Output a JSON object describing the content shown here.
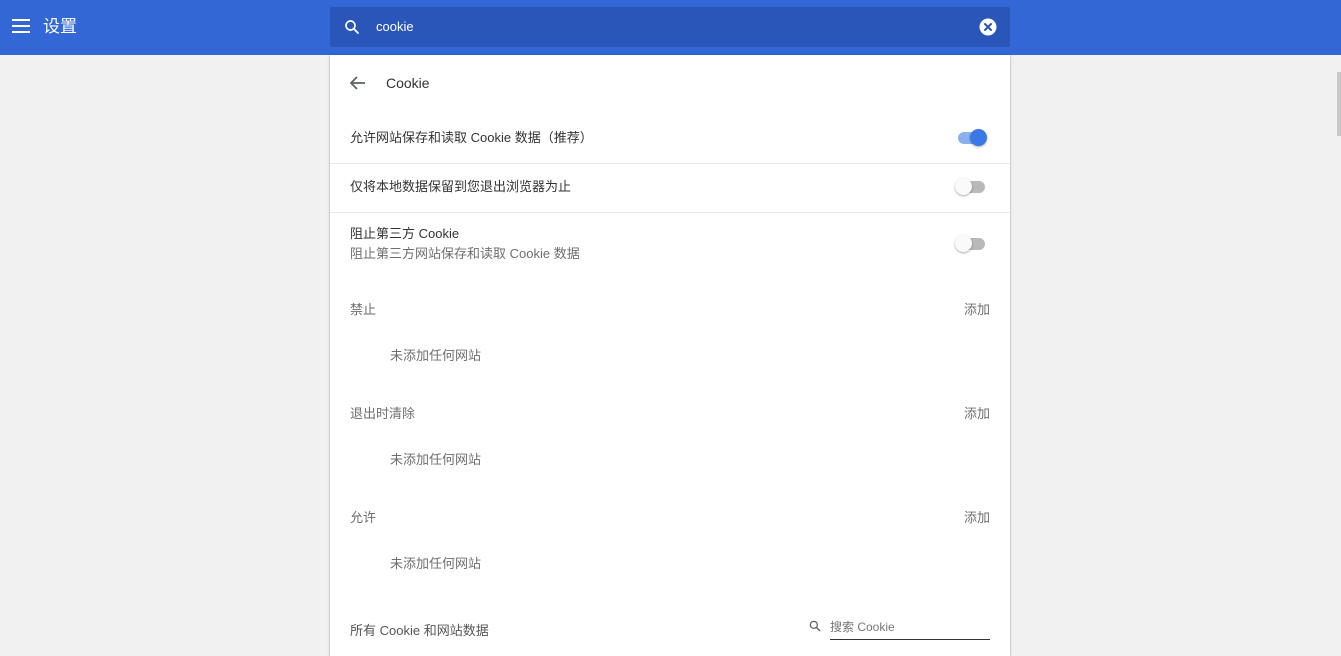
{
  "header": {
    "title": "设置",
    "search_value": "cookie"
  },
  "page": {
    "title": "Cookie"
  },
  "toggles": [
    {
      "label": "允许网站保存和读取 Cookie 数据（推荐）",
      "state": "on"
    },
    {
      "label": "仅将本地数据保留到您退出浏览器为止",
      "state": "off"
    },
    {
      "label": "阻止第三方 Cookie",
      "sublabel": "阻止第三方网站保存和读取 Cookie 数据",
      "state": "off"
    }
  ],
  "sections": [
    {
      "title": "禁止",
      "add_label": "添加",
      "empty_text": "未添加任何网站"
    },
    {
      "title": "退出时清除",
      "add_label": "添加",
      "empty_text": "未添加任何网站"
    },
    {
      "title": "允许",
      "add_label": "添加",
      "empty_text": "未添加任何网站"
    }
  ],
  "all_cookies": {
    "label": "所有 Cookie 和网站数据",
    "search_placeholder": "搜索 Cookie"
  },
  "colors": {
    "header_bg": "#3367d6",
    "search_bg": "#2a56b9",
    "toggle_on": "#3b78e7"
  }
}
